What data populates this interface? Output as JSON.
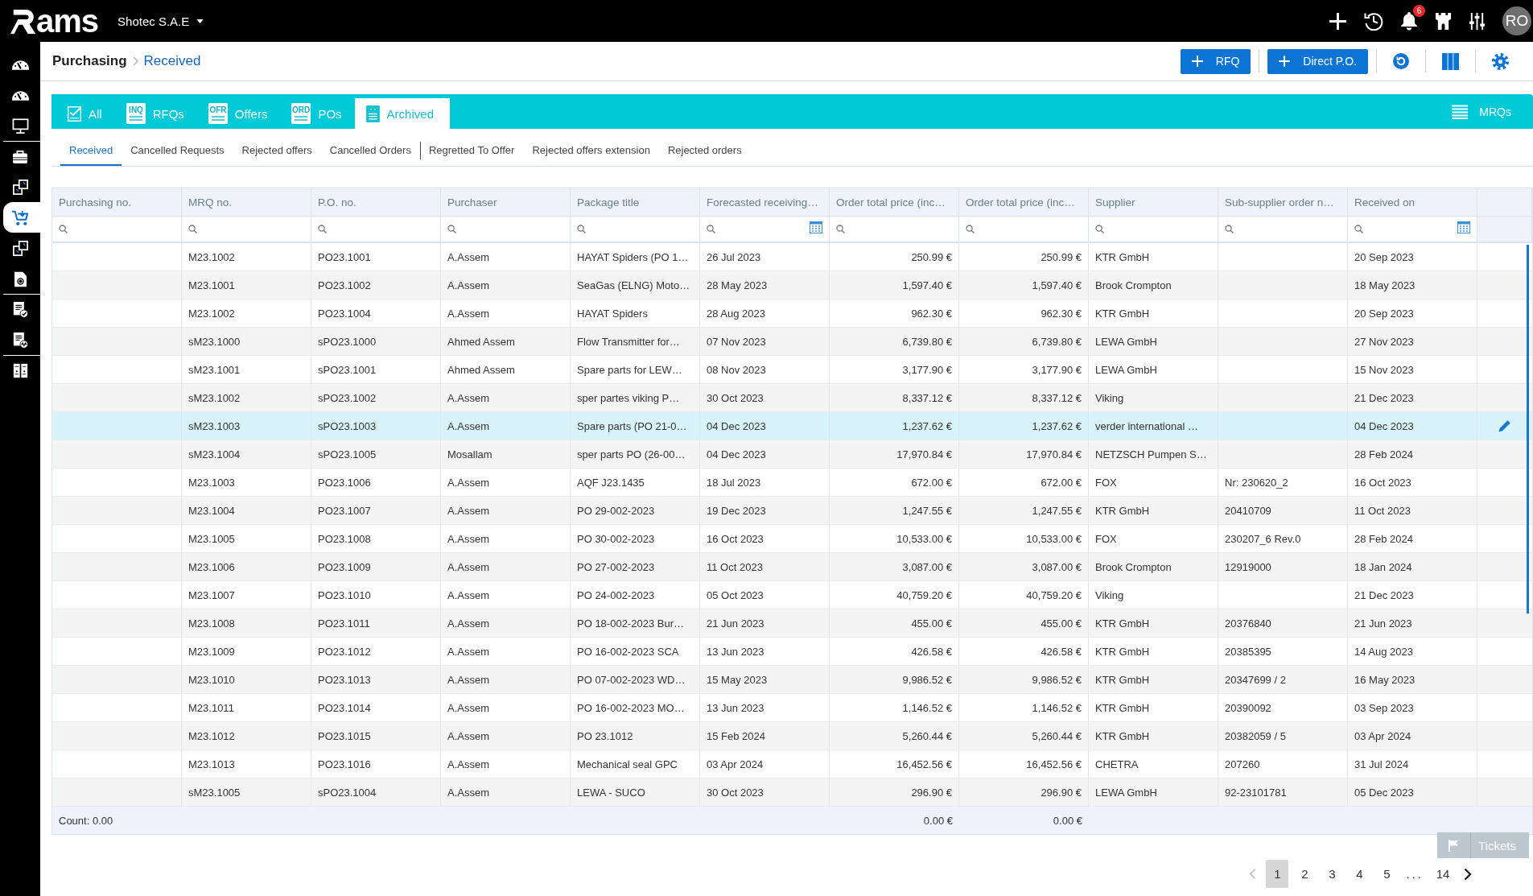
{
  "top_bar": {
    "logo_text": "ams",
    "company": "Shotec S.A.E",
    "notification_count": "6",
    "avatar_initials": "RO"
  },
  "sidebar": {
    "items": [
      {
        "selected": false,
        "group_start": false
      },
      {
        "selected": false,
        "group_start": false
      },
      {
        "selected": false,
        "group_start": false
      },
      {
        "selected": false,
        "group_start": true
      },
      {
        "selected": false,
        "group_start": false
      },
      {
        "selected": true,
        "group_start": false
      },
      {
        "selected": false,
        "group_start": false
      },
      {
        "selected": false,
        "group_start": false
      },
      {
        "selected": false,
        "group_start": true
      },
      {
        "selected": false,
        "group_start": false
      },
      {
        "selected": false,
        "group_start": true
      }
    ]
  },
  "breadcrumb": [
    "Purchasing",
    "Received"
  ],
  "header_buttons": [
    "RFQ",
    "Direct P.O."
  ],
  "main_tabs": [
    {
      "label": "All",
      "kind": "checklist",
      "selected": false
    },
    {
      "label": "RFQs",
      "kind": "document",
      "icon_text": "INQ",
      "selected": false
    },
    {
      "label": "Offers",
      "kind": "document",
      "icon_text": "OFR",
      "selected": false
    },
    {
      "label": "POs",
      "kind": "document",
      "icon_text": "ORD",
      "selected": false
    },
    {
      "label": "Archived",
      "kind": "archive",
      "selected": true
    }
  ],
  "mrqs_link": "MRQs",
  "sub_tabs": [
    {
      "label": "Received",
      "selected": true,
      "group_start": false
    },
    {
      "label": "Cancelled Requests",
      "selected": false,
      "group_start": false
    },
    {
      "label": "Rejected offers",
      "selected": false,
      "group_start": false
    },
    {
      "label": "Cancelled Orders",
      "selected": false,
      "group_start": false
    },
    {
      "label": "Regretted To Offer",
      "selected": false,
      "group_start": true
    },
    {
      "label": "Rejected offers extension",
      "selected": false,
      "group_start": false
    },
    {
      "label": "Rejected orders",
      "selected": false,
      "group_start": false
    }
  ],
  "table": {
    "columns": [
      {
        "label": "Purchasing no.",
        "kind": "text",
        "date_filter": false
      },
      {
        "label": "MRQ no.",
        "kind": "text",
        "date_filter": false
      },
      {
        "label": "P.O. no.",
        "kind": "text",
        "date_filter": false
      },
      {
        "label": "Purchaser",
        "kind": "text",
        "date_filter": false
      },
      {
        "label": "Package title",
        "kind": "text",
        "date_filter": false
      },
      {
        "label": "Forecasted receiving…",
        "kind": "text",
        "date_filter": true
      },
      {
        "label": "Order total price (inc…",
        "kind": "money",
        "date_filter": false
      },
      {
        "label": "Order total price (inc…",
        "kind": "money",
        "date_filter": false
      },
      {
        "label": "Supplier",
        "kind": "text",
        "date_filter": false
      },
      {
        "label": "Sub-supplier order n…",
        "kind": "text",
        "date_filter": false
      },
      {
        "label": "Received on",
        "kind": "text",
        "date_filter": true
      }
    ],
    "rows": [
      {
        "selected": false,
        "mrq_no": "M23.1002",
        "po_no": "PO23.1001",
        "purchaser": "A.Assem",
        "package_title": "HAYAT Spiders (PO 1…",
        "forecasted_receiving": "26 Jul 2023",
        "order_total_price_inc_1": "250.99 €",
        "order_total_price_inc_2": "250.99 €",
        "supplier": "KTR GmbH",
        "received_on": "20 Sep 2023"
      },
      {
        "selected": false,
        "mrq_no": "M23.1001",
        "po_no": "PO23.1002",
        "purchaser": "A.Assem",
        "package_title": "SeaGas (ELNG) Moto…",
        "forecasted_receiving": "28 May 2023",
        "order_total_price_inc_1": "1,597.40 €",
        "order_total_price_inc_2": "1,597.40 €",
        "supplier": "Brook Crompton",
        "received_on": "18 May 2023"
      },
      {
        "selected": false,
        "mrq_no": "M23.1002",
        "po_no": "PO23.1004",
        "purchaser": "A.Assem",
        "package_title": "HAYAT Spiders",
        "forecasted_receiving": "28 Aug 2023",
        "order_total_price_inc_1": "962.30 €",
        "order_total_price_inc_2": "962.30 €",
        "supplier": "KTR GmbH",
        "received_on": "20 Sep 2023"
      },
      {
        "selected": false,
        "mrq_no": "sM23.1000",
        "po_no": "sPO23.1000",
        "purchaser": "Ahmed Assem",
        "package_title": "Flow Transmitter for…",
        "forecasted_receiving": "07 Nov 2023",
        "order_total_price_inc_1": "6,739.80 €",
        "order_total_price_inc_2": "6,739.80 €",
        "supplier": "LEWA GmbH",
        "received_on": "27 Nov 2023"
      },
      {
        "selected": false,
        "mrq_no": "sM23.1001",
        "po_no": "sPO23.1001",
        "purchaser": "Ahmed Assem",
        "package_title": "Spare parts for LEW…",
        "forecasted_receiving": "08 Nov 2023",
        "order_total_price_inc_1": "3,177.90 €",
        "order_total_price_inc_2": "3,177.90 €",
        "supplier": "LEWA GmbH",
        "received_on": "15 Nov 2023"
      },
      {
        "selected": false,
        "mrq_no": "sM23.1002",
        "po_no": "sPO23.1002",
        "purchaser": "A.Assem",
        "package_title": "sper partes viking P…",
        "forecasted_receiving": "30 Oct 2023",
        "order_total_price_inc_1": "8,337.12 €",
        "order_total_price_inc_2": "8,337.12 €",
        "supplier": "Viking",
        "received_on": "21 Dec 2023"
      },
      {
        "selected": true,
        "mrq_no": "sM23.1003",
        "po_no": "sPO23.1003",
        "purchaser": "A.Assem",
        "package_title": "Spare parts (PO 21-0…",
        "forecasted_receiving": "04 Dec 2023",
        "order_total_price_inc_1": "1,237.62 €",
        "order_total_price_inc_2": "1,237.62 €",
        "supplier": "verder international …",
        "received_on": "04 Dec 2023"
      },
      {
        "selected": false,
        "mrq_no": "sM23.1004",
        "po_no": "sPO23.1005",
        "purchaser": "Mosallam",
        "package_title": "sper parts PO (26-00…",
        "forecasted_receiving": "04 Dec 2023",
        "order_total_price_inc_1": "17,970.84 €",
        "order_total_price_inc_2": "17,970.84 €",
        "supplier": "NETZSCH Pumpen S…",
        "received_on": "28 Feb 2024"
      },
      {
        "selected": false,
        "mrq_no": "M23.1003",
        "po_no": "PO23.1006",
        "purchaser": "A.Assem",
        "package_title": "AQF J23.1435",
        "forecasted_receiving": "18 Jul 2023",
        "order_total_price_inc_1": "672.00 €",
        "order_total_price_inc_2": "672.00 €",
        "supplier": "FOX",
        "sub_supplier_order_n": "Nr: 230620_2",
        "received_on": "16 Oct 2023"
      },
      {
        "selected": false,
        "mrq_no": "M23.1004",
        "po_no": "PO23.1007",
        "purchaser": "A.Assem",
        "package_title": "PO 29-002-2023",
        "forecasted_receiving": "19 Dec 2023",
        "order_total_price_inc_1": "1,247.55 €",
        "order_total_price_inc_2": "1,247.55 €",
        "supplier": "KTR GmbH",
        "sub_supplier_order_n": "20410709",
        "received_on": "11 Oct 2023"
      },
      {
        "selected": false,
        "mrq_no": "M23.1005",
        "po_no": "PO23.1008",
        "purchaser": "A.Assem",
        "package_title": "PO 30-002-2023",
        "forecasted_receiving": "16 Oct 2023",
        "order_total_price_inc_1": "10,533.00 €",
        "order_total_price_inc_2": "10,533.00 €",
        "supplier": "FOX",
        "sub_supplier_order_n": "230207_6 Rev.0",
        "received_on": "28 Feb 2024"
      },
      {
        "selected": false,
        "mrq_no": "M23.1006",
        "po_no": "PO23.1009",
        "purchaser": "A.Assem",
        "package_title": "PO 27-002-2023",
        "forecasted_receiving": "11 Oct 2023",
        "order_total_price_inc_1": "3,087.00 €",
        "order_total_price_inc_2": "3,087.00 €",
        "supplier": "Brook Crompton",
        "sub_supplier_order_n": "12919000",
        "received_on": "18 Jan 2024"
      },
      {
        "selected": false,
        "mrq_no": "M23.1007",
        "po_no": "PO23.1010",
        "purchaser": "A.Assem",
        "package_title": "PO 24-002-2023",
        "forecasted_receiving": "05 Oct 2023",
        "order_total_price_inc_1": "40,759.20 €",
        "order_total_price_inc_2": "40,759.20 €",
        "supplier": "Viking",
        "received_on": "21 Dec 2023"
      },
      {
        "selected": false,
        "mrq_no": "M23.1008",
        "po_no": "PO23.1011",
        "purchaser": "A.Assem",
        "package_title": "PO 18-002-2023 Bur…",
        "forecasted_receiving": "21 Jun 2023",
        "order_total_price_inc_1": "455.00 €",
        "order_total_price_inc_2": "455.00 €",
        "supplier": "KTR GmbH",
        "sub_supplier_order_n": "20376840",
        "received_on": "21 Jun 2023"
      },
      {
        "selected": false,
        "mrq_no": "M23.1009",
        "po_no": "PO23.1012",
        "purchaser": "A.Assem",
        "package_title": "PO 16-002-2023 SCA",
        "forecasted_receiving": "13 Jun 2023",
        "order_total_price_inc_1": "426.58 €",
        "order_total_price_inc_2": "426.58 €",
        "supplier": "KTR GmbH",
        "sub_supplier_order_n": "20385395",
        "received_on": "14 Aug 2023"
      },
      {
        "selected": false,
        "mrq_no": "M23.1010",
        "po_no": "PO23.1013",
        "purchaser": "A.Assem",
        "package_title": "PO 07-002-2023 WD…",
        "forecasted_receiving": "15 May 2023",
        "order_total_price_inc_1": "9,986.52 €",
        "order_total_price_inc_2": "9,986.52 €",
        "supplier": "KTR GmbH",
        "sub_supplier_order_n": "20347699 / 2",
        "received_on": "16 May 2023"
      },
      {
        "selected": false,
        "mrq_no": "M23.1011",
        "po_no": "PO23.1014",
        "purchaser": "A.Assem",
        "package_title": "PO 16-002-2023 MO…",
        "forecasted_receiving": "13 Jun 2023",
        "order_total_price_inc_1": "1,146.52 €",
        "order_total_price_inc_2": "1,146.52 €",
        "supplier": "KTR GmbH",
        "sub_supplier_order_n": "20390092",
        "received_on": "03 Sep 2023"
      },
      {
        "selected": false,
        "mrq_no": "M23.1012",
        "po_no": "PO23.1015",
        "purchaser": "A.Assem",
        "package_title": "PO 23.1012",
        "forecasted_receiving": "15 Feb 2024",
        "order_total_price_inc_1": "5,260.44 €",
        "order_total_price_inc_2": "5,260.44 €",
        "supplier": "KTR GmbH",
        "sub_supplier_order_n": "20382059 / 5",
        "received_on": "03 Apr 2024"
      },
      {
        "selected": false,
        "mrq_no": "M23.1013",
        "po_no": "PO23.1016",
        "purchaser": "A.Assem",
        "package_title": "Mechanical seal GPC",
        "forecasted_receiving": "03 Apr 2024",
        "order_total_price_inc_1": "16,452.56 €",
        "order_total_price_inc_2": "16,452.56 €",
        "supplier": "CHETRA",
        "sub_supplier_order_n": "207260",
        "received_on": "31 Jul 2024"
      },
      {
        "selected": false,
        "mrq_no": "sM23.1005",
        "po_no": "sPO23.1004",
        "purchaser": "A.Assem",
        "package_title": "LEWA - SUCO",
        "forecasted_receiving": "30 Oct 2023",
        "order_total_price_inc_1": "296.90 €",
        "order_total_price_inc_2": "296.90 €",
        "supplier": "LEWA GmbH",
        "sub_supplier_order_n": "92-23101781",
        "received_on": "05 Dec 2023"
      }
    ],
    "footer": {
      "count": "Count: 0.00",
      "totals": [
        "0.00 €",
        "0.00 €"
      ]
    }
  },
  "pagination": {
    "previous": {
      "disabled": true
    },
    "next": {
      "disabled": false
    },
    "pages": [
      {
        "label": "1",
        "kind": "page",
        "selected": true
      },
      {
        "label": "2",
        "kind": "page",
        "selected": false
      },
      {
        "label": "3",
        "kind": "page",
        "selected": false
      },
      {
        "label": "4",
        "kind": "page",
        "selected": false
      },
      {
        "label": "5",
        "kind": "page",
        "selected": false
      },
      {
        "label": "...",
        "kind": "ellipsis",
        "selected": false
      },
      {
        "label": "14",
        "kind": "page",
        "selected": false
      }
    ]
  },
  "tickets_button": "Tickets"
}
